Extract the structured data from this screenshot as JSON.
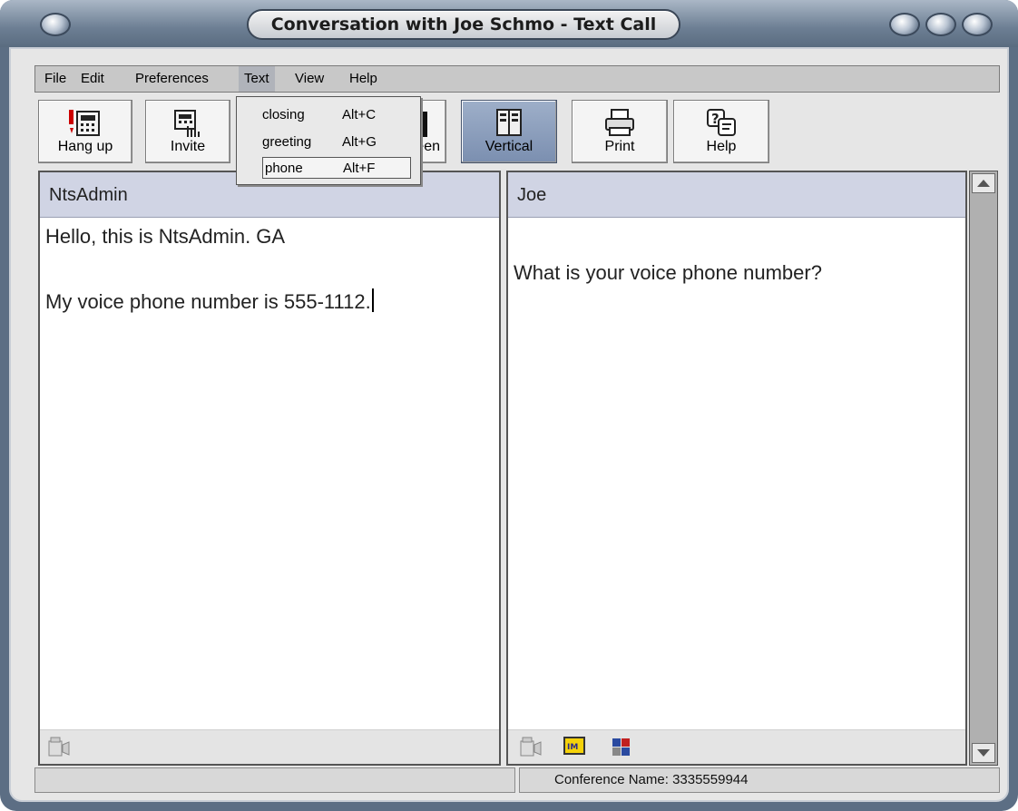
{
  "window": {
    "title": "Conversation with Joe Schmo - Text Call"
  },
  "menubar": {
    "items": [
      {
        "label": "File"
      },
      {
        "label": "Edit"
      },
      {
        "label": "Preferences"
      },
      {
        "label": "Text"
      },
      {
        "label": "View"
      },
      {
        "label": "Help"
      }
    ]
  },
  "toolbar": {
    "hangup_label": "Hang up",
    "invite_label": "Invite",
    "screen_label_partial": "een",
    "vertical_label": "Vertical",
    "print_label": "Print",
    "help_label": "Help"
  },
  "text_menu": {
    "items": [
      {
        "label": "closing",
        "shortcut": "Alt+C"
      },
      {
        "label": "greeting",
        "shortcut": "Alt+G"
      },
      {
        "label": "phone",
        "shortcut": "Alt+F"
      }
    ]
  },
  "left_pane": {
    "name": "NtsAdmin",
    "lines": [
      "Hello, this is NtsAdmin.  GA",
      "My voice phone number is 555-1112."
    ]
  },
  "right_pane": {
    "name": "Joe",
    "lines": [
      "What is your voice phone number?"
    ]
  },
  "status": {
    "conference": "Conference Name: 3335559944"
  },
  "icons": {
    "hangup": "hang-up-phone-icon",
    "invite": "invite-phone-icon",
    "vertical": "vertical-split-icon",
    "print": "printer-icon",
    "help": "help-icon"
  }
}
